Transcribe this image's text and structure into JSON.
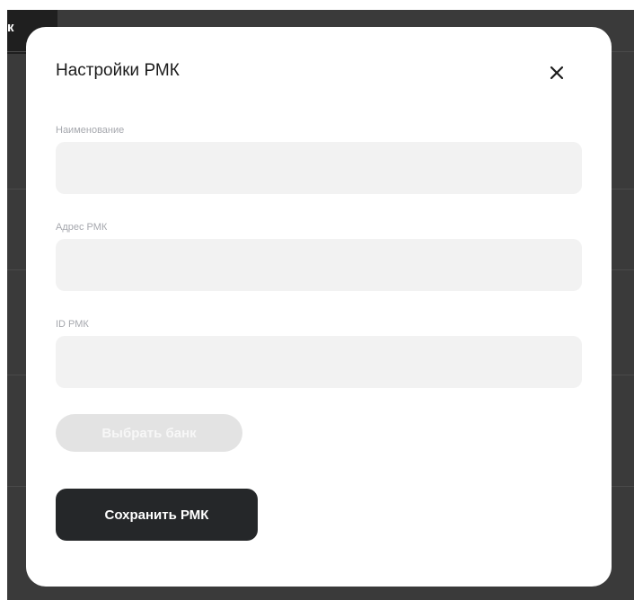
{
  "background": {
    "tab_label": "к"
  },
  "modal": {
    "title": "Настройки РМК",
    "close_icon": "close-icon",
    "fields": {
      "name": {
        "label": "Наименование",
        "value": "",
        "placeholder": ""
      },
      "address": {
        "label": "Адрес РМК",
        "value": "",
        "placeholder": ""
      },
      "id": {
        "label": "ID РМК",
        "value": "",
        "placeholder": ""
      }
    },
    "choose_bank_label": "Выбрать банк",
    "save_label": "Сохранить РМК"
  },
  "colors": {
    "backdrop": "#3a3a3a",
    "primary_button": "#252729",
    "disabled_button": "#e3e3e3",
    "input_background": "#f2f2f2"
  }
}
